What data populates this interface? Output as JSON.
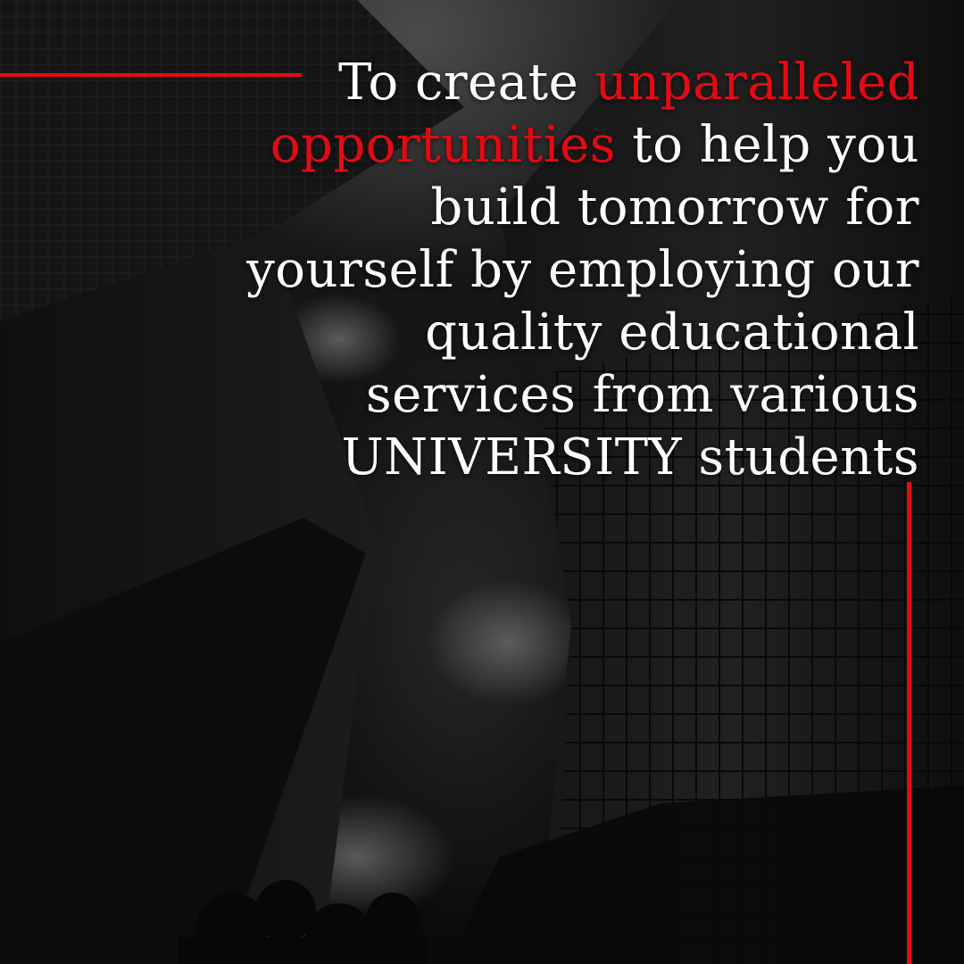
{
  "colors": {
    "accent": "#e50914",
    "text": "#ffffff",
    "background": "#111111"
  },
  "headline": {
    "line1": {
      "before": "To create ",
      "highlight": "unparalleled"
    },
    "line2": {
      "highlight": "opportunities",
      "after": " to help you"
    },
    "line3": "build tomorrow for",
    "line4": "yourself by employing our",
    "line5": "quality educational",
    "line6": "services from various",
    "line7": "UNIVERSITY students"
  }
}
